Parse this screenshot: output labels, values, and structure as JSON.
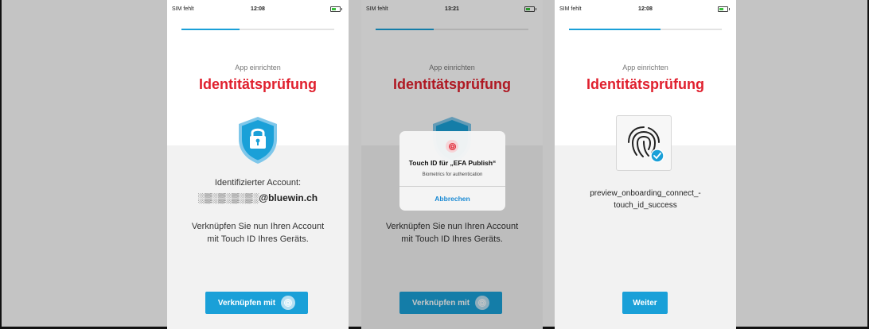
{
  "screens": [
    {
      "status": {
        "carrier": "SIM fehlt",
        "time": "12:08"
      },
      "header": {
        "subtitle": "App einrichten",
        "title": "Identitätsprüfung"
      },
      "icon": "shield-lock-icon",
      "account": {
        "label": "Identifizierter Account:",
        "value": "░▒░▒░▒░▒░@bluewin.ch"
      },
      "info_line1": "Verknüpfen Sie nun Ihren Account",
      "info_line2": "mit Touch ID Ihres Geräts.",
      "button": {
        "label": "Verknüpfen mit",
        "icon": "fingerprint-icon"
      },
      "progress": 0.38
    },
    {
      "status": {
        "carrier": "SIM fehlt",
        "time": "13:21"
      },
      "header": {
        "subtitle": "App einrichten",
        "title": "Identitätsprüfung"
      },
      "icon": "shield-lock-icon",
      "info_line1": "Verknüpfen Sie nun Ihren Account",
      "info_line2": "mit Touch ID Ihres Geräts.",
      "button": {
        "label": "Verknüpfen mit",
        "icon": "fingerprint-icon"
      },
      "progress": 0.38,
      "dialog": {
        "title": "Touch ID für „EFA Publish“",
        "subtitle": "Biometrics for authentication",
        "cancel": "Abbrechen",
        "icon": "fingerprint-icon"
      }
    },
    {
      "status": {
        "carrier": "SIM fehlt",
        "time": "12:08"
      },
      "header": {
        "subtitle": "App einrichten",
        "title": "Identitätsprüfung"
      },
      "icon": "fingerprint-check-icon",
      "info_line1": "preview_onboarding_connect_-",
      "info_line2": "touch_id_success",
      "button": {
        "label": "Weiter"
      },
      "progress": 0.6
    }
  ],
  "colors": {
    "accent": "#1aa0d8",
    "title_red": "#e0202e",
    "background": "#c4c4c4"
  }
}
